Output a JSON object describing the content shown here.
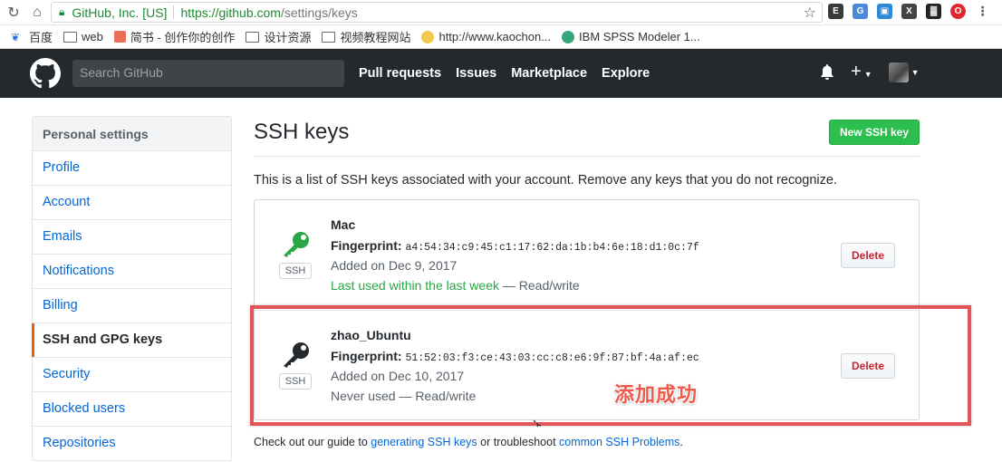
{
  "browser": {
    "org": "GitHub, Inc. [US]",
    "url_base": "https://github.com",
    "url_path": "/settings/keys",
    "bookmarks": [
      {
        "label": "百度",
        "icon": "baidu-icon"
      },
      {
        "label": "web",
        "icon": "folder-icon"
      },
      {
        "label": "简书 - 创作你的创作",
        "icon": "jianshu-icon"
      },
      {
        "label": "设计资源",
        "icon": "folder-icon"
      },
      {
        "label": "视频教程网站",
        "icon": "folder-icon"
      },
      {
        "label": "http://www.kaochon...",
        "icon": "smiley-icon"
      },
      {
        "label": "IBM SPSS Modeler 1...",
        "icon": "spss-icon"
      }
    ]
  },
  "header": {
    "search_placeholder": "Search GitHub",
    "nav": [
      "Pull requests",
      "Issues",
      "Marketplace",
      "Explore"
    ],
    "plus": "+"
  },
  "sidebar": {
    "heading": "Personal settings",
    "items": [
      {
        "label": "Profile"
      },
      {
        "label": "Account"
      },
      {
        "label": "Emails"
      },
      {
        "label": "Notifications"
      },
      {
        "label": "Billing"
      },
      {
        "label": "SSH and GPG keys",
        "selected": true
      },
      {
        "label": "Security"
      },
      {
        "label": "Blocked users"
      },
      {
        "label": "Repositories"
      }
    ]
  },
  "main": {
    "title": "SSH keys",
    "new_key_label": "New SSH key",
    "intro": "This is a list of SSH keys associated with your account. Remove any keys that you do not recognize.",
    "keys": [
      {
        "name": "Mac",
        "fingerprint_label": "Fingerprint:",
        "fingerprint": "a4:54:34:c9:45:c1:17:62:da:1b:b4:6e:18:d1:0c:7f",
        "added": "Added on Dec 9, 2017",
        "usage_status": "Last used within the last week",
        "access": " — Read/write",
        "badge": "SSH",
        "delete_label": "Delete",
        "icon_color": "#28a745"
      },
      {
        "name": "zhao_Ubuntu",
        "fingerprint_label": "Fingerprint:",
        "fingerprint": "51:52:03:f3:ce:43:03:cc:c8:e6:9f:87:bf:4a:af:ec",
        "added": "Added on Dec 10, 2017",
        "usage_status": "Never used",
        "access": " — Read/write",
        "badge": "SSH",
        "delete_label": "Delete",
        "icon_color": "#24292e"
      }
    ],
    "annotation": "添加成功",
    "footer": {
      "prefix": "Check out our guide to ",
      "link1": "generating SSH keys",
      "middle": " or troubleshoot ",
      "link2": "common SSH Problems",
      "suffix": "."
    }
  },
  "colors": {
    "accent_green": "#2cbe4e",
    "link_blue": "#0366d6",
    "highlight_red": "#e2545a",
    "header_bg": "#24292e"
  }
}
